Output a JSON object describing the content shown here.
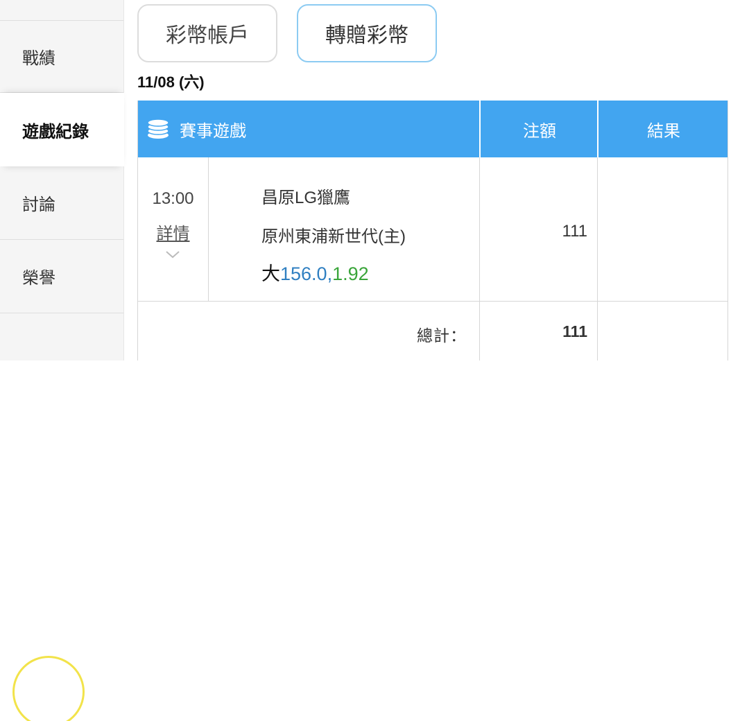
{
  "sidebar": {
    "items": [
      {
        "label": "戰績"
      },
      {
        "label": "遊戲紀錄",
        "active": true
      },
      {
        "label": "討論"
      },
      {
        "label": "榮譽"
      }
    ]
  },
  "tabs": [
    {
      "label": "彩幣帳戶"
    },
    {
      "label": "轉贈彩幣",
      "selected": true
    }
  ],
  "date": "11/08 (六)",
  "table": {
    "headers": {
      "game": "賽事遊戲",
      "bet": "注額",
      "result": "結果"
    },
    "rows": [
      {
        "time": "13:00",
        "detail_link": "詳情",
        "away_team": "昌原LG獵鷹",
        "home_team": "原州東浦新世代(主)",
        "pick_label": "大",
        "pick_line": "156.0",
        "pick_sep": ",",
        "pick_odds": "1.92",
        "amount": "111",
        "result": ""
      }
    ],
    "total_label": "總計：",
    "total_value": "111"
  },
  "colors": {
    "header_bg": "#42a5f0",
    "line_blue": "#2f7fc1",
    "odds_green": "#3aa53a",
    "selected_tab_border": "#8ccbf2"
  },
  "icons": {
    "coins": "coins-icon",
    "chevron": "chevron-down-icon"
  }
}
